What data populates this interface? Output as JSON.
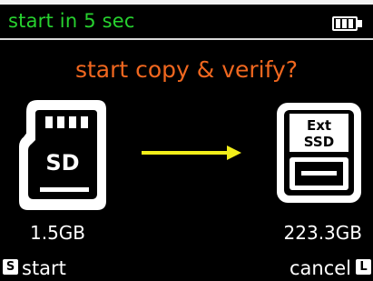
{
  "status": {
    "text": "start in 5 sec",
    "battery": "battery-icon"
  },
  "dialog": {
    "prompt": "start copy & verify?"
  },
  "source": {
    "label": "SD",
    "size": "1.5GB",
    "icon": "sd-card-icon"
  },
  "destination": {
    "line1": "Ext",
    "line2": "SSD",
    "size": "223.3GB",
    "icon": "ext-ssd-icon"
  },
  "transfer": {
    "icon": "arrow-right-icon"
  },
  "footer": {
    "start_key": "S",
    "start_label": "start",
    "cancel_key": "L",
    "cancel_label": "cancel"
  },
  "colors": {
    "status": "#27d12f",
    "prompt": "#f0671f",
    "arrow": "#f2ee1a"
  }
}
